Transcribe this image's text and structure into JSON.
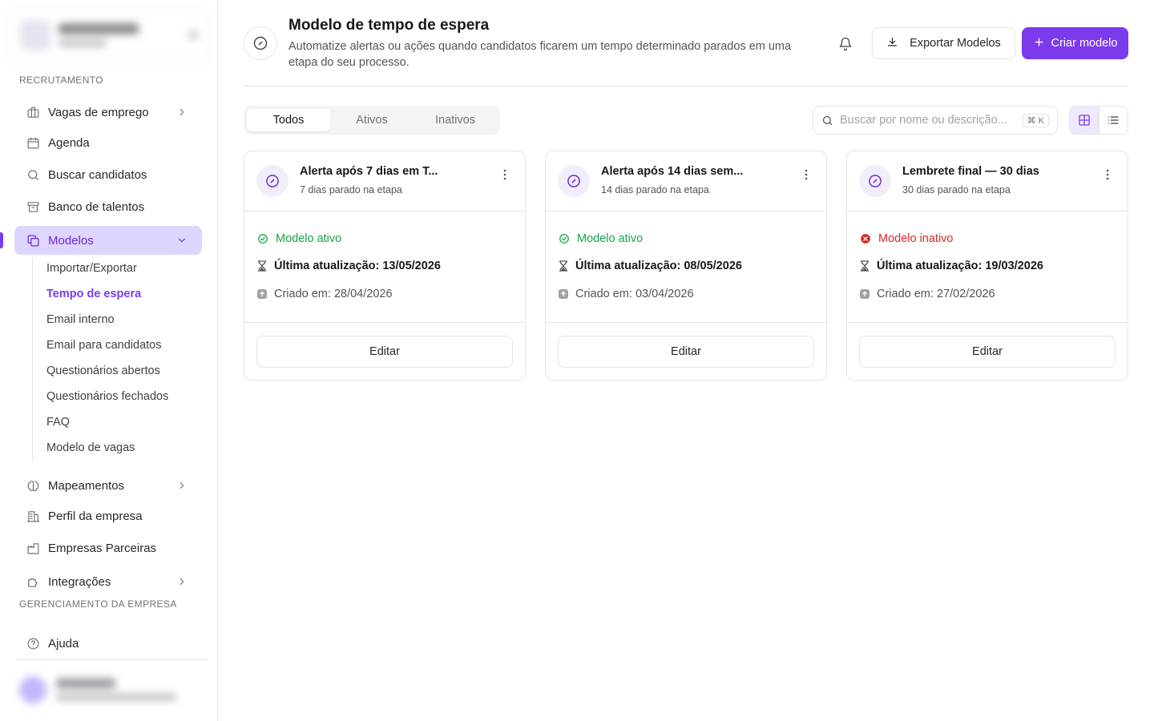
{
  "sidebar": {
    "sections": {
      "recruitment": "RECRUTAMENTO",
      "company": "GERENCIAMENTO DA EMPRESA"
    },
    "items": {
      "jobs": "Vagas de emprego",
      "schedule": "Agenda",
      "search": "Buscar candidatos",
      "talents": "Banco de talentos",
      "templates": "Modelos",
      "mappings": "Mapeamentos",
      "profile": "Perfil da empresa",
      "partners": "Empresas Parceiras",
      "integrations": "Integrações",
      "help": "Ajuda"
    },
    "subitems": [
      "Importar/Exportar",
      "Tempo de espera",
      "Email interno",
      "Email para candidatos",
      "Questionários abertos",
      "Questionários fechados",
      "FAQ",
      "Modelo de vagas"
    ]
  },
  "header": {
    "title": "Modelo de tempo de espera",
    "description": "Automatize alertas ou ações quando candidatos ficarem um tempo determinado parados em uma etapa do seu processo.",
    "export_label": "Exportar Modelos",
    "create_label": "Criar modelo"
  },
  "tabs": [
    "Todos",
    "Ativos",
    "Inativos"
  ],
  "search": {
    "placeholder": "Buscar por nome ou descrição...",
    "shortcut": "⌘ K"
  },
  "cards": [
    {
      "title": "Alerta após 7 dias em T...",
      "subtitle": "7 dias parado na etapa",
      "status": "Modelo ativo",
      "updated": "Última atualização: 13/05/2026",
      "created": "Criado em: 28/04/2026",
      "edit_label": "Editar"
    },
    {
      "title": "Alerta após 14 dias sem...",
      "subtitle": "14 dias parado na etapa",
      "status": "Modelo ativo",
      "updated": "Última atualização: 08/05/2026",
      "created": "Criado em: 03/04/2026",
      "edit_label": "Editar"
    },
    {
      "title": "Lembrete final — 30 dias",
      "subtitle": "30 dias parado na etapa",
      "status": "Modelo inativo",
      "updated": "Última atualização: 19/03/2026",
      "created": "Criado em: 27/02/2026",
      "edit_label": "Editar"
    }
  ],
  "colors": {
    "accent": "#7c3aed",
    "active": "#16a34a",
    "inactive": "#dc2626"
  }
}
